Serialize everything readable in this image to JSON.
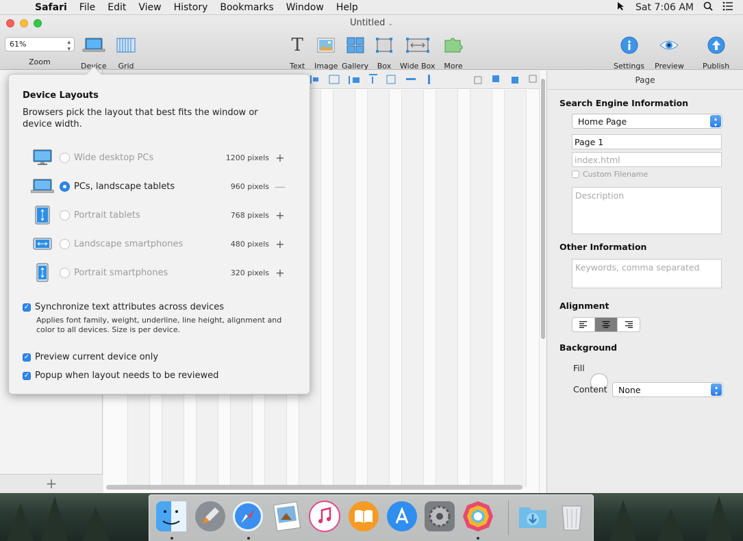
{
  "menubar": {
    "app": "Safari",
    "items": [
      "File",
      "Edit",
      "View",
      "History",
      "Bookmarks",
      "Window",
      "Help"
    ],
    "clock": "Sat 7:06 AM"
  },
  "window": {
    "title": "Untitled"
  },
  "toolbar": {
    "zoom_value": "61%",
    "zoom_label": "Zoom",
    "device_label": "Device",
    "grid_label": "Grid",
    "text_label": "Text",
    "image_label": "Image",
    "gallery_label": "Gallery",
    "box_label": "Box",
    "widebox_label": "Wide Box",
    "more_label": "More",
    "settings_label": "Settings",
    "preview_label": "Preview",
    "publish_label": "Publish"
  },
  "popover": {
    "title": "Device Layouts",
    "description": "Browsers pick the layout that best fits the window or device width.",
    "devices": [
      {
        "name": "Wide desktop PCs",
        "pixels": "1200 pixels",
        "selected": false,
        "action": "+"
      },
      {
        "name": "PCs, landscape tablets",
        "pixels": "960 pixels",
        "selected": true,
        "action": "—"
      },
      {
        "name": "Portrait tablets",
        "pixels": "768 pixels",
        "selected": false,
        "action": "+"
      },
      {
        "name": "Landscape smartphones",
        "pixels": "480 pixels",
        "selected": false,
        "action": "+"
      },
      {
        "name": "Portrait smartphones",
        "pixels": "320 pixels",
        "selected": false,
        "action": "+"
      }
    ],
    "sync_label": "Synchronize text attributes across devices",
    "sync_desc": "Applies font family, weight, underline, line height, alignment and color to all devices. Size is per device.",
    "preview_only_label": "Preview current device only",
    "popup_label": "Popup when layout needs to be reviewed",
    "sync_checked": true,
    "preview_only_checked": true,
    "popup_checked": true
  },
  "inspector": {
    "tab": "Page",
    "seo_heading": "Search Engine Information",
    "page_select": "Home Page",
    "page_name": "Page 1",
    "filename_placeholder": "index.html",
    "custom_filename_label": "Custom Filename",
    "description_placeholder": "Description",
    "other_heading": "Other Information",
    "keywords_placeholder": "Keywords, comma separated",
    "alignment_heading": "Alignment",
    "alignment_selected": "center",
    "background_heading": "Background",
    "fill_label": "Fill",
    "content_label": "Content",
    "content_value": "None"
  },
  "leftpanel": {
    "add_label": "+"
  },
  "colors": {
    "accent": "#2e86f0",
    "close": "#fc605c",
    "minimize": "#fdbc40",
    "zoom": "#34c84a"
  }
}
